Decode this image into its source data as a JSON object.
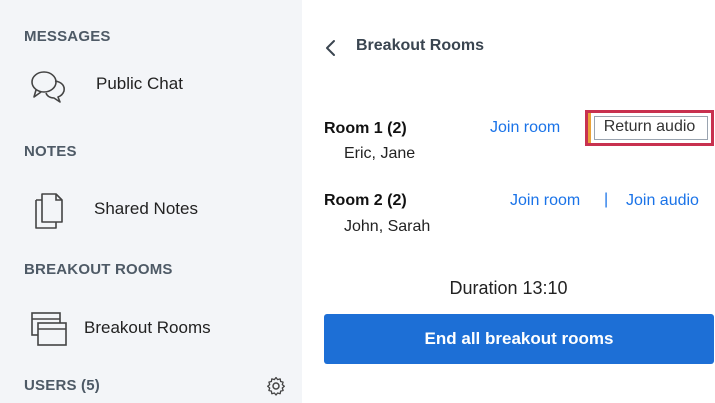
{
  "sidebar": {
    "messages": {
      "title": "MESSAGES",
      "items": [
        {
          "label": "Public Chat",
          "icon": "chat-bubbles-icon"
        }
      ]
    },
    "notes": {
      "title": "NOTES",
      "items": [
        {
          "label": "Shared Notes",
          "icon": "document-icon"
        }
      ]
    },
    "breakout": {
      "title": "BREAKOUT ROOMS",
      "items": [
        {
          "label": "Breakout Rooms",
          "icon": "windows-icon"
        }
      ]
    },
    "users": {
      "title": "USERS (5)",
      "settings_icon": "gear-icon"
    }
  },
  "main": {
    "header": {
      "title": "Breakout Rooms",
      "back_icon": "chevron-left-icon"
    },
    "rooms": [
      {
        "name": "Room 1 (2)",
        "members": "Eric, Jane",
        "join_room": "Join room",
        "audio_action": "Return audio"
      },
      {
        "name": "Room 2 (2)",
        "members": "John, Sarah",
        "join_room": "Join room",
        "separator": "|",
        "audio_action": "Join audio"
      }
    ],
    "duration": "Duration 13:10",
    "end_button": "End all breakout rooms"
  },
  "colors": {
    "sidebar_bg": "#f3f5f8",
    "link": "#1a73e8",
    "primary_button": "#1d6fd6",
    "highlight_border": "#c8314f"
  }
}
